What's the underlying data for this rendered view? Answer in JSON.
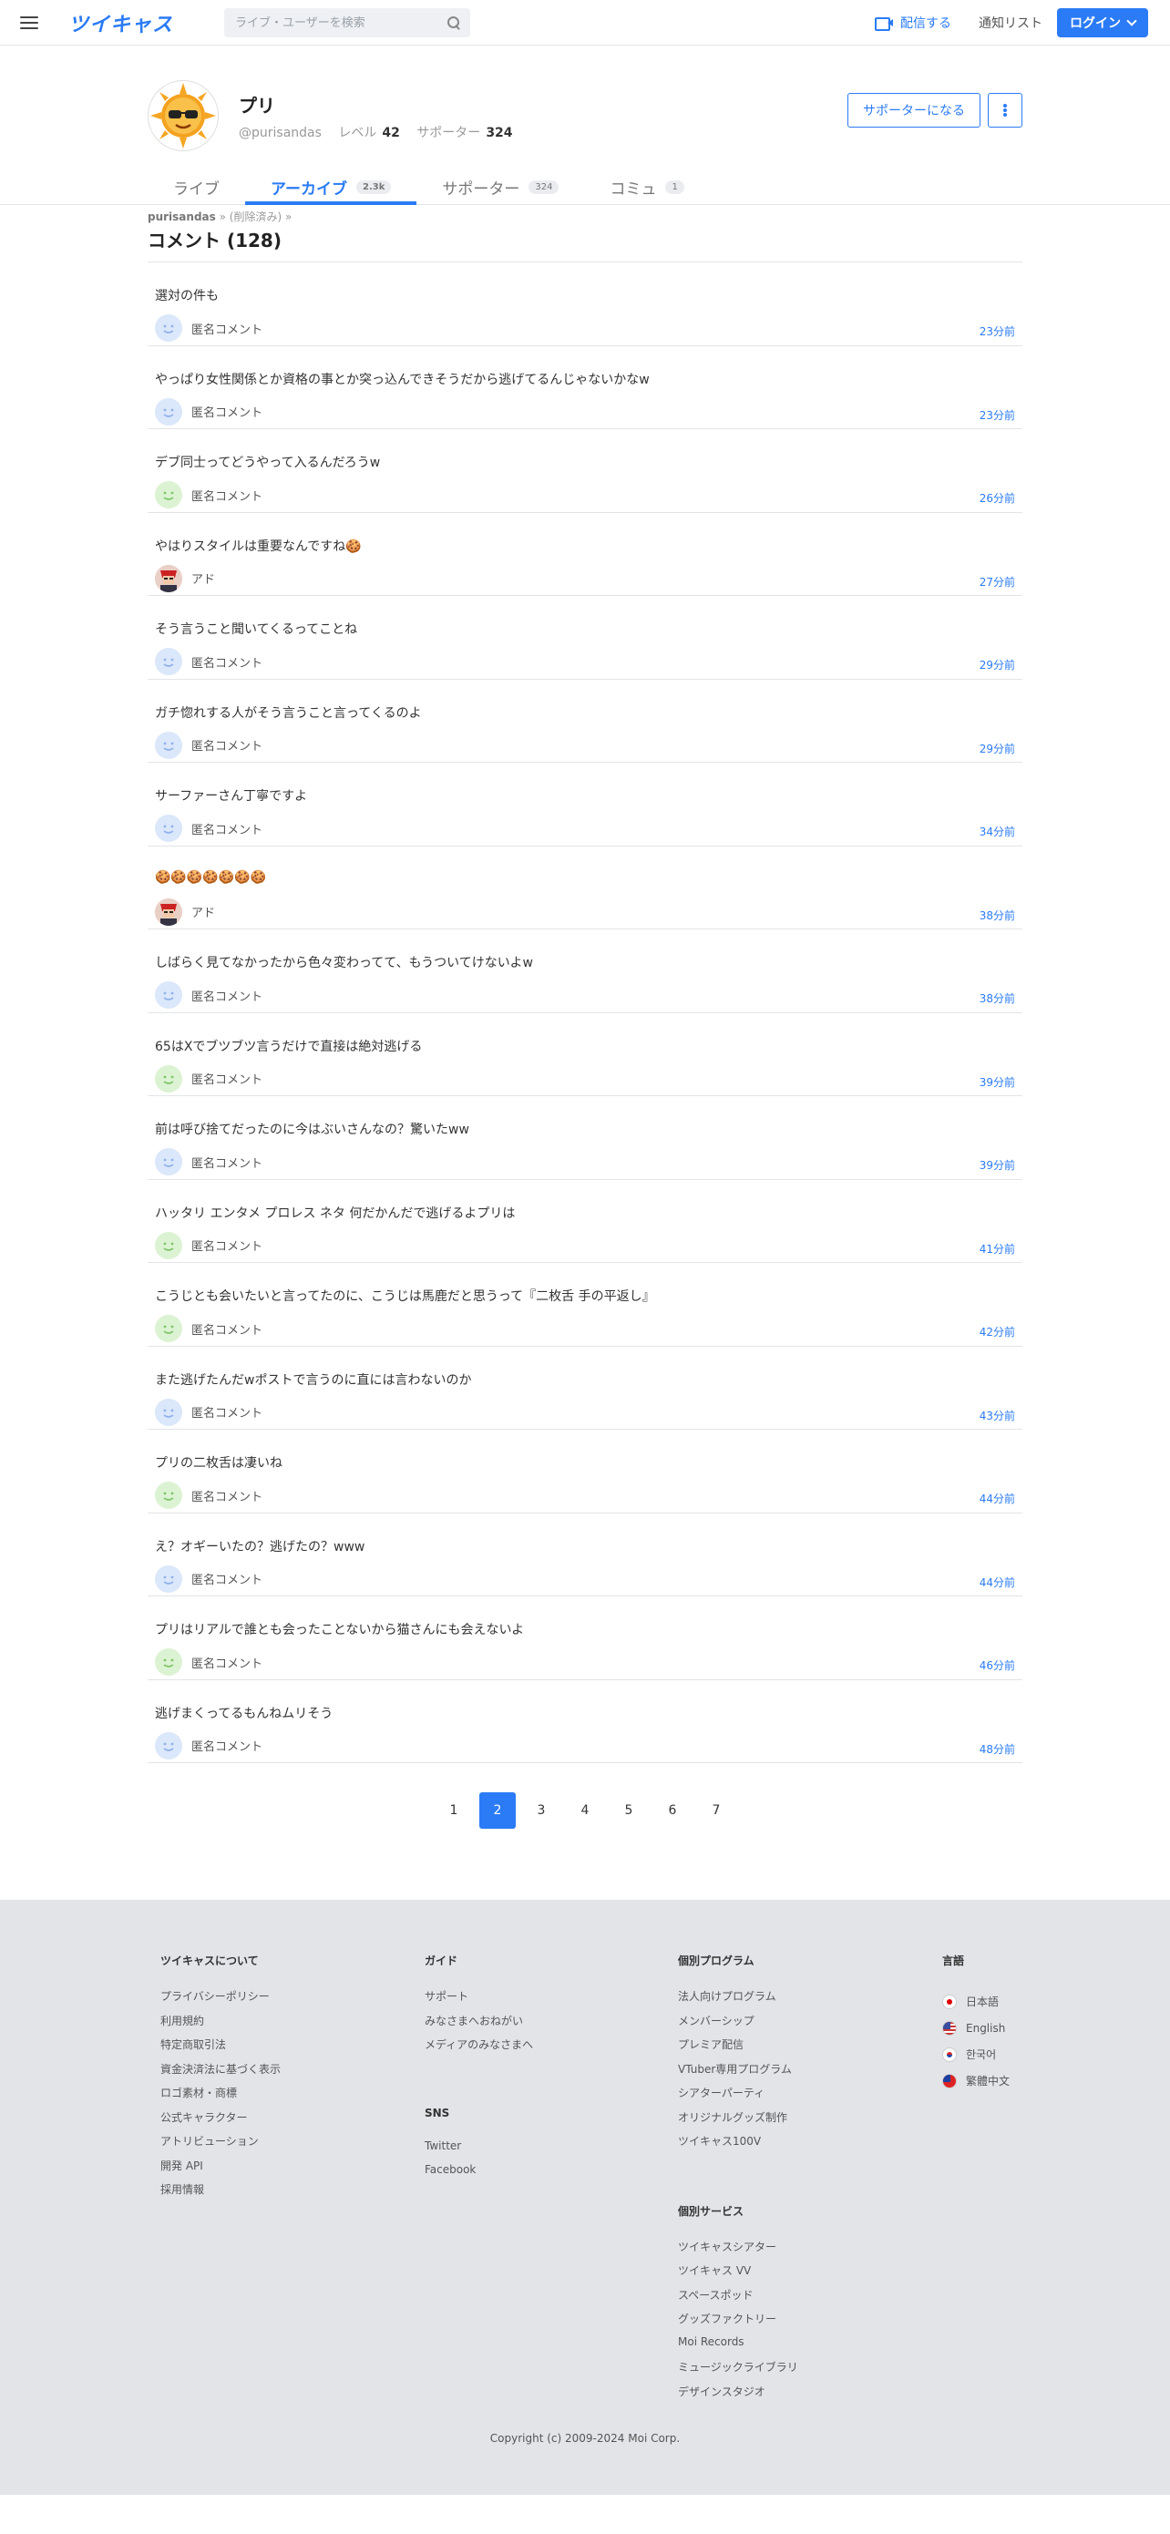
{
  "header": {
    "logo": "ツイキャス",
    "search_placeholder": "ライブ・ユーザーを検索",
    "broadcast_label": "配信する",
    "notify_label": "通知リスト",
    "login_label": "ログイン"
  },
  "profile": {
    "name": "プリ",
    "handle": "@purisandas",
    "level_label": "レベル",
    "level": "42",
    "supporter_label": "サポーター",
    "supporter_count": "324",
    "supporter_button": "サポーターになる"
  },
  "tabs": [
    {
      "label": "ライブ",
      "count": ""
    },
    {
      "label": "アーカイブ",
      "count": "2.3k"
    },
    {
      "label": "サポーター",
      "count": "324"
    },
    {
      "label": "コミュ",
      "count": "1"
    }
  ],
  "breadcrumb": {
    "user": "purisandas",
    "sep1": "»",
    "item": "(削除済み)",
    "sep2": "»"
  },
  "section_title": "コメント (128)",
  "comments": [
    {
      "text": "選対の件も",
      "user": "匿名コメント",
      "icon": "blue",
      "time": "23分前"
    },
    {
      "text": "やっぱり女性関係とか資格の事とか突っ込んできそうだから逃げてるんじゃないかなw",
      "user": "匿名コメント",
      "icon": "blue",
      "time": "23分前"
    },
    {
      "text": "デブ同士ってどうやって入るんだろうw",
      "user": "匿名コメント",
      "icon": "green",
      "time": "26分前"
    },
    {
      "text": "やはりスタイルは重要なんですね🍪",
      "user": "アド",
      "icon": "face",
      "time": "27分前"
    },
    {
      "text": "そう言うこと聞いてくるってことね",
      "user": "匿名コメント",
      "icon": "blue",
      "time": "29分前"
    },
    {
      "text": "ガチ惚れする人がそう言うこと言ってくるのよ",
      "user": "匿名コメント",
      "icon": "blue",
      "time": "29分前"
    },
    {
      "text": "サーファーさん丁寧ですよ",
      "user": "匿名コメント",
      "icon": "blue",
      "time": "34分前"
    },
    {
      "text": "🍪🍪🍪🍪🍪🍪🍪",
      "user": "アド",
      "icon": "face",
      "time": "38分前"
    },
    {
      "text": "しばらく見てなかったから色々変わってて、もうついてけないよw",
      "user": "匿名コメント",
      "icon": "blue",
      "time": "38分前"
    },
    {
      "text": "65はXでブツブツ言うだけで直接は絶対逃げる",
      "user": "匿名コメント",
      "icon": "green",
      "time": "39分前"
    },
    {
      "text": "前は呼び捨てだったのに今はぶいさんなの？驚いたww",
      "user": "匿名コメント",
      "icon": "blue",
      "time": "39分前"
    },
    {
      "text": "ハッタリ エンタメ プロレス ネタ 何だかんだで逃げるよプリは",
      "user": "匿名コメント",
      "icon": "green",
      "time": "41分前"
    },
    {
      "text": "こうじとも会いたいと言ってたのに、こうじは馬鹿だと思うって『二枚舌 手の平返し』",
      "user": "匿名コメント",
      "icon": "green",
      "time": "42分前"
    },
    {
      "text": "また逃げたんだwポストで言うのに直には言わないのか",
      "user": "匿名コメント",
      "icon": "blue",
      "time": "43分前"
    },
    {
      "text": "プリの二枚舌は凄いね",
      "user": "匿名コメント",
      "icon": "green",
      "time": "44分前"
    },
    {
      "text": "え？オギーいたの？逃げたの？www",
      "user": "匿名コメント",
      "icon": "blue",
      "time": "44分前"
    },
    {
      "text": "プリはリアルで誰とも会ったことないから猫さんにも会えないよ",
      "user": "匿名コメント",
      "icon": "green",
      "time": "46分前"
    },
    {
      "text": "逃げまくってるもんねムリそう",
      "user": "匿名コメント",
      "icon": "blue",
      "time": "48分前"
    }
  ],
  "pagination": {
    "pages": [
      "1",
      "2",
      "3",
      "4",
      "5",
      "6",
      "7"
    ],
    "current": "2"
  },
  "footer": {
    "col1": {
      "title": "ツイキャスについて",
      "links": [
        "プライバシーポリシー",
        "利用規約",
        "特定商取引法",
        "資金決済法に基づく表示",
        "ロゴ素材・商標",
        "公式キャラクター",
        "アトリビューション",
        "開発 API",
        "採用情報"
      ]
    },
    "col2": {
      "title": "ガイド",
      "links": [
        "サポート",
        "みなさまへおねがい",
        "メディアのみなさまへ"
      ]
    },
    "col2b": {
      "title": "SNS",
      "links": [
        "Twitter",
        "Facebook"
      ]
    },
    "col3": {
      "title": "個別プログラム",
      "links": [
        "法人向けプログラム",
        "メンバーシップ",
        "プレミア配信",
        "VTuber専用プログラム",
        "シアターパーティ",
        "オリジナルグッズ制作",
        "ツイキャス100V"
      ]
    },
    "col3b": {
      "title": "個別サービス",
      "links": [
        "ツイキャスシアター",
        "ツイキャス VV",
        "スペースポッド",
        "グッズファクトリー",
        "Moi Records",
        "ミュージックライブラリ",
        "デザインスタジオ"
      ]
    },
    "col4": {
      "title": "言語",
      "langs": [
        {
          "label": "日本語",
          "flag": "jp"
        },
        {
          "label": "English",
          "flag": "us"
        },
        {
          "label": "한국어",
          "flag": "kr"
        },
        {
          "label": "繁體中文",
          "flag": "tw"
        }
      ]
    },
    "copyright": "Copyright (c) 2009-2024 Moi Corp."
  },
  "colors": {
    "accent": "#2a7bf5",
    "footer_bg": "#e2e4e8"
  }
}
